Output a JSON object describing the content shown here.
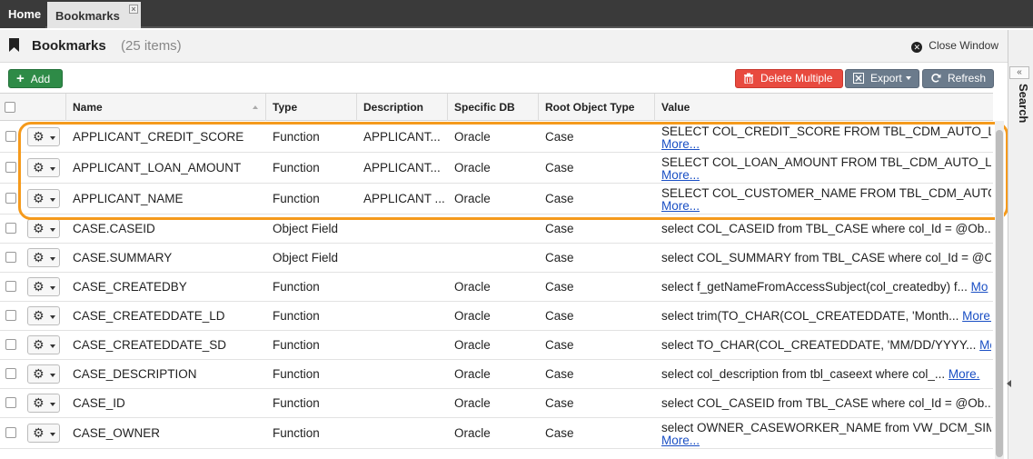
{
  "tabs": {
    "home": "Home",
    "active": "Bookmarks",
    "close": "×"
  },
  "header": {
    "title": "Bookmarks",
    "count": "(25 items)",
    "close_window": "Close Window"
  },
  "toolbar": {
    "add": "Add",
    "delete_multiple": "Delete Multiple",
    "export": "Export",
    "refresh": "Refresh"
  },
  "columns": {
    "name": "Name",
    "type": "Type",
    "description": "Description",
    "specific_db": "Specific DB",
    "root_object_type": "Root Object Type",
    "value": "Value"
  },
  "more_label": "More...",
  "side_panel": {
    "label": "Search",
    "collapse": "«"
  },
  "rows": [
    {
      "name": "APPLICANT_CREDIT_SCORE",
      "type": "Function",
      "description": "APPLICANT...",
      "db": "Oracle",
      "root": "Case",
      "value": "SELECT COL_CREDIT_SCORE FROM TBL_CDM_AUTO_LOA",
      "more": "More..."
    },
    {
      "name": "APPLICANT_LOAN_AMOUNT",
      "type": "Function",
      "description": "APPLICANT...",
      "db": "Oracle",
      "root": "Case",
      "value": "SELECT COL_LOAN_AMOUNT FROM TBL_CDM_AUTO_LOA",
      "more": "More..."
    },
    {
      "name": "APPLICANT_NAME",
      "type": "Function",
      "description": "APPLICANT ...",
      "db": "Oracle",
      "root": "Case",
      "value": "SELECT COL_CUSTOMER_NAME FROM TBL_CDM_AUTO_L",
      "more": "More..."
    },
    {
      "name": "CASE.CASEID",
      "type": "Object Field",
      "description": "",
      "db": "",
      "root": "Case",
      "value": "select COL_CASEID from TBL_CASE where col_Id = @Ob...",
      "more": ""
    },
    {
      "name": "CASE.SUMMARY",
      "type": "Object Field",
      "description": "",
      "db": "",
      "root": "Case",
      "value": "select COL_SUMMARY from TBL_CASE where col_Id = @O",
      "more": ""
    },
    {
      "name": "CASE_CREATEDBY",
      "type": "Function",
      "description": "",
      "db": "Oracle",
      "root": "Case",
      "value": "select f_getNameFromAccessSubject(col_createdby) f...",
      "more": "Mo"
    },
    {
      "name": "CASE_CREATEDDATE_LD",
      "type": "Function",
      "description": "",
      "db": "Oracle",
      "root": "Case",
      "value": "select trim(TO_CHAR(COL_CREATEDDATE, 'Month...",
      "more": "More."
    },
    {
      "name": "CASE_CREATEDDATE_SD",
      "type": "Function",
      "description": "",
      "db": "Oracle",
      "root": "Case",
      "value": "select TO_CHAR(COL_CREATEDDATE, 'MM/DD/YYYY...",
      "more": "Mor"
    },
    {
      "name": "CASE_DESCRIPTION",
      "type": "Function",
      "description": "",
      "db": "Oracle",
      "root": "Case",
      "value": "select col_description from tbl_caseext where col_...",
      "more": "More."
    },
    {
      "name": "CASE_ID",
      "type": "Function",
      "description": "",
      "db": "Oracle",
      "root": "Case",
      "value": "select COL_CASEID from TBL_CASE where col_Id = @Ob...",
      "more": "More."
    },
    {
      "name": "CASE_OWNER",
      "type": "Function",
      "description": "",
      "db": "Oracle",
      "root": "Case",
      "value": "select OWNER_CASEWORKER_NAME from VW_DCM_SIMP",
      "more": "More..."
    }
  ]
}
